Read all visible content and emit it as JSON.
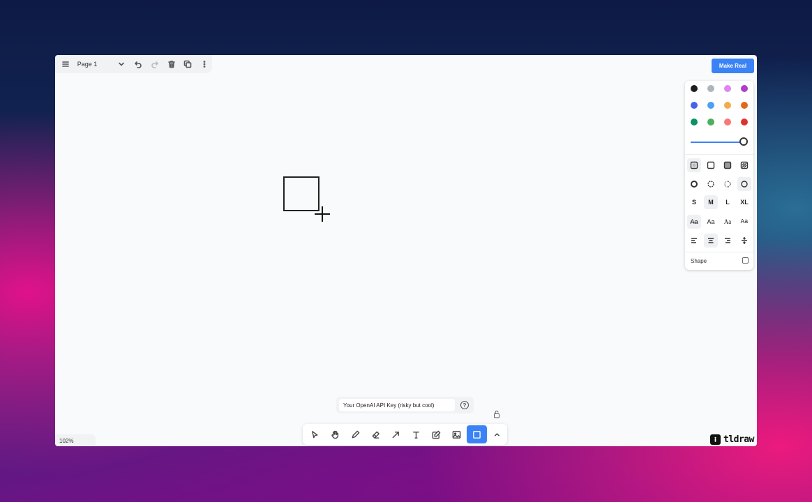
{
  "header": {
    "page_name": "Page 1",
    "make_real_label": "Make Real"
  },
  "style_panel": {
    "colors": [
      {
        "name": "black",
        "hex": "#1d1d1d"
      },
      {
        "name": "grey",
        "hex": "#adb5bd"
      },
      {
        "name": "light-violet",
        "hex": "#e085f4"
      },
      {
        "name": "violet",
        "hex": "#ae3ec9"
      },
      {
        "name": "blue",
        "hex": "#4465e9"
      },
      {
        "name": "light-blue",
        "hex": "#4ba1f1"
      },
      {
        "name": "yellow",
        "hex": "#f1ac4b"
      },
      {
        "name": "orange",
        "hex": "#e16919"
      },
      {
        "name": "green",
        "hex": "#099268"
      },
      {
        "name": "light-green",
        "hex": "#4cb05e"
      },
      {
        "name": "light-red",
        "hex": "#f87777"
      },
      {
        "name": "red",
        "hex": "#e03131"
      }
    ],
    "selected_color": "black",
    "opacity": 1.0,
    "sizes": [
      "S",
      "M",
      "L",
      "XL"
    ],
    "selected_size": "M",
    "fonts": [
      "Aa",
      "Aa",
      "Aa",
      "Aa"
    ],
    "shape_label": "Shape"
  },
  "api_key": {
    "placeholder": "Your OpenAI API Key (risky but cool)",
    "help_glyph": "?"
  },
  "toolbar": {
    "tools": [
      "select",
      "hand",
      "draw",
      "eraser",
      "arrow",
      "text",
      "note",
      "media",
      "rectangle",
      "more"
    ],
    "active_tool": "rectangle"
  },
  "footer": {
    "zoom": "102%",
    "logo_text": "tldraw"
  },
  "colors": {
    "accent": "#3b82f6",
    "canvas": "#f9fafb"
  }
}
